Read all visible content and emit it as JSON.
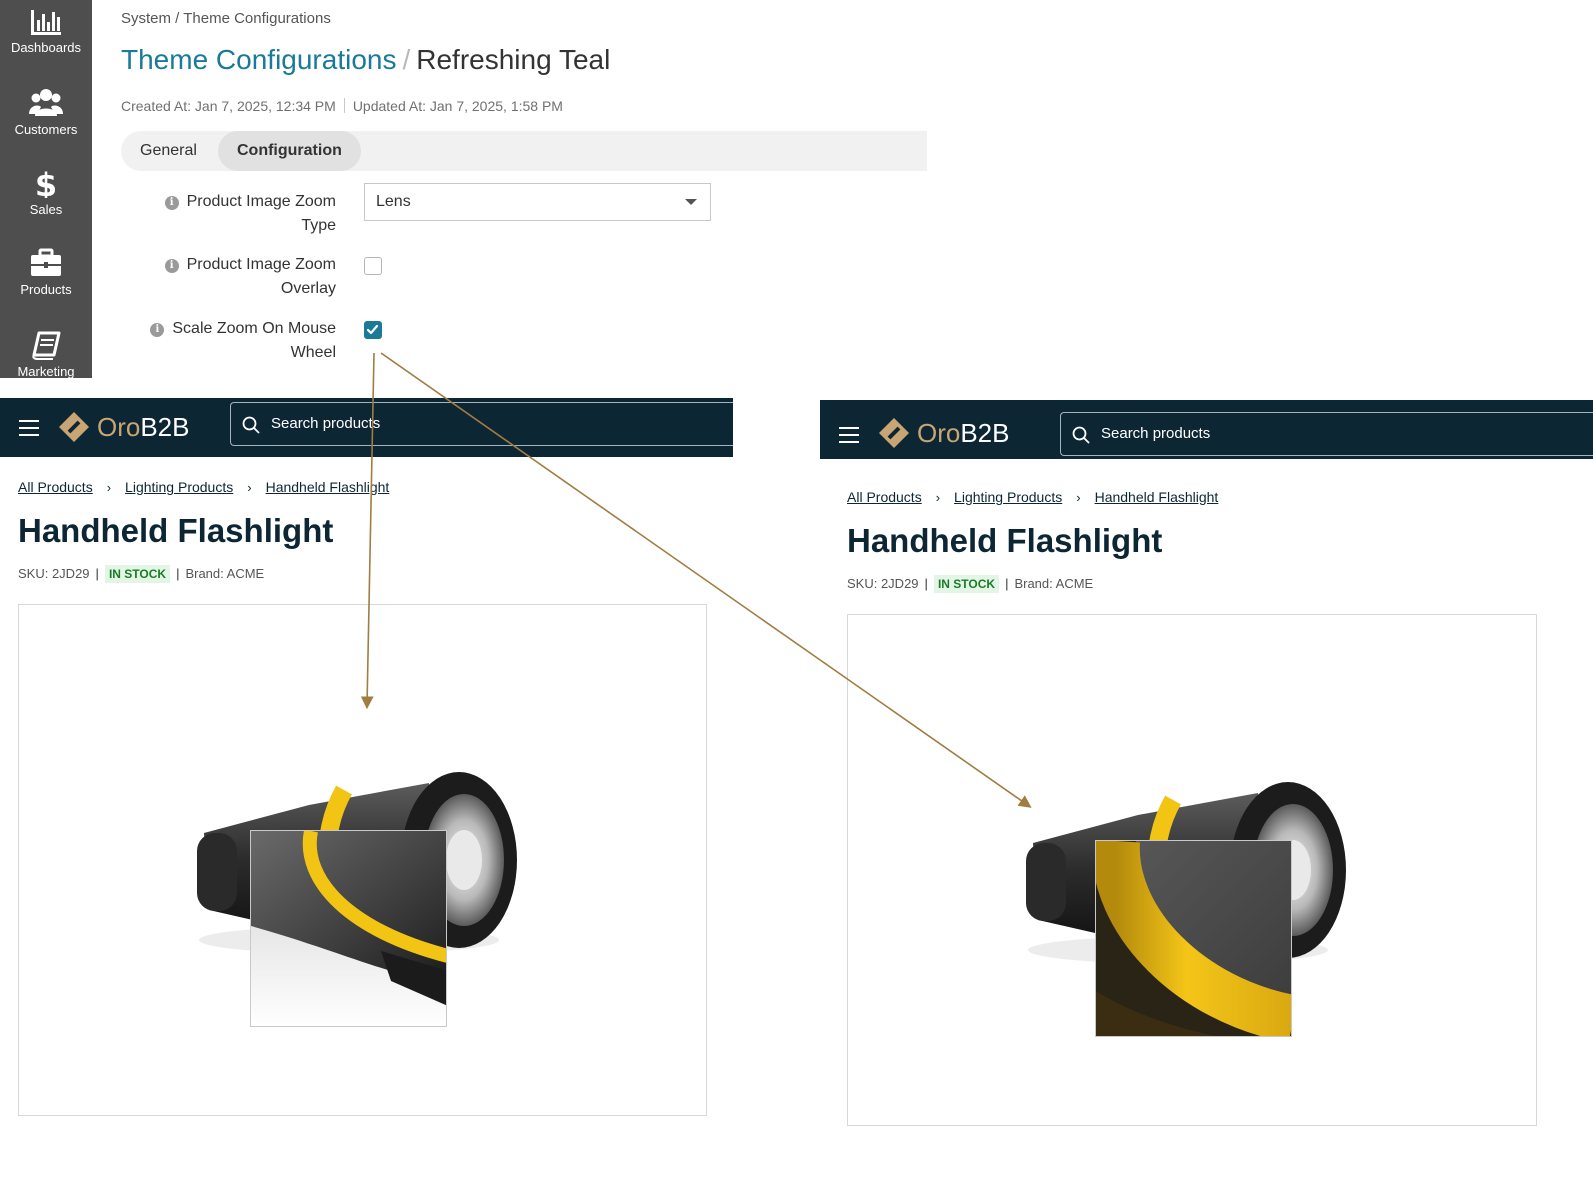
{
  "sidebar": {
    "items": [
      {
        "label": "Dashboards",
        "icon": "bar-chart-icon"
      },
      {
        "label": "Customers",
        "icon": "users-icon"
      },
      {
        "label": "Sales",
        "icon": "dollar-icon"
      },
      {
        "label": "Products",
        "icon": "briefcase-icon"
      },
      {
        "label": "Marketing",
        "icon": "book-icon"
      }
    ]
  },
  "admin": {
    "breadcrumb": "System / Theme Configurations",
    "title_link": "Theme Configurations",
    "title_sep": "/",
    "title_current": "Refreshing Teal",
    "created": "Created At: Jan 7, 2025, 12:34 PM",
    "updated": "Updated At: Jan 7, 2025, 1:58 PM",
    "tabs": [
      {
        "label": "General",
        "active": false
      },
      {
        "label": "Configuration",
        "active": true
      }
    ],
    "fields": {
      "zoom_type": {
        "label_line1": "Product Image Zoom",
        "label_line2": "Type",
        "value": "Lens"
      },
      "zoom_overlay": {
        "label_line1": "Product Image Zoom",
        "label_line2": "Overlay",
        "checked": false
      },
      "scale_zoom": {
        "label_line1": "Scale Zoom On Mouse",
        "label_line2": "Wheel",
        "checked": true
      }
    }
  },
  "storefront": {
    "logo_oro": "Oro",
    "logo_b2b": "B2B",
    "search_placeholder": "Search products",
    "breadcrumbs": [
      "All Products",
      "Lighting Products",
      "Handheld Flashlight"
    ],
    "product_title": "Handheld Flashlight",
    "sku": "SKU: 2JD29",
    "stock": "IN STOCK",
    "brand": "Brand: ACME"
  },
  "colors": {
    "accent": "#1a7a9a",
    "nav_bg": "#0c2634",
    "logo_gold": "#c8a572",
    "arrow": "#a07d43",
    "stock_green": "#1d7a2b"
  }
}
